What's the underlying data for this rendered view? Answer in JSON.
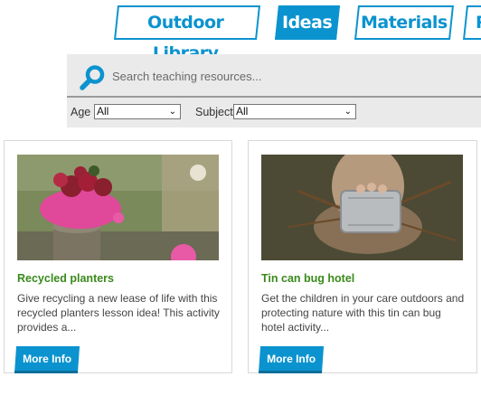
{
  "nav": {
    "tabs": [
      {
        "label": "Outdoor Library",
        "active": false
      },
      {
        "label": "Ideas",
        "active": true
      },
      {
        "label": "Materials",
        "active": false
      },
      {
        "label": "R",
        "active": false
      }
    ]
  },
  "search": {
    "placeholder": "Search teaching resources...",
    "value": "",
    "icon": "search-icon"
  },
  "filters": {
    "age": {
      "label": "Age",
      "value": "All"
    },
    "subject": {
      "label": "Subject",
      "value": "All"
    }
  },
  "cards": [
    {
      "title": "Recycled planters",
      "description": "Give recycling a new lease of life with this recycled planters lesson idea! This activity provides a...",
      "button": "More Info"
    },
    {
      "title": "Tin can bug hotel",
      "description": "Get the children in your care outdoors and protecting nature with this tin can bug hotel activity...",
      "button": "More Info"
    }
  ],
  "colors": {
    "accent": "#0b93cf",
    "title_green": "#3a8a1c",
    "panel_bg": "#eaeaea"
  }
}
